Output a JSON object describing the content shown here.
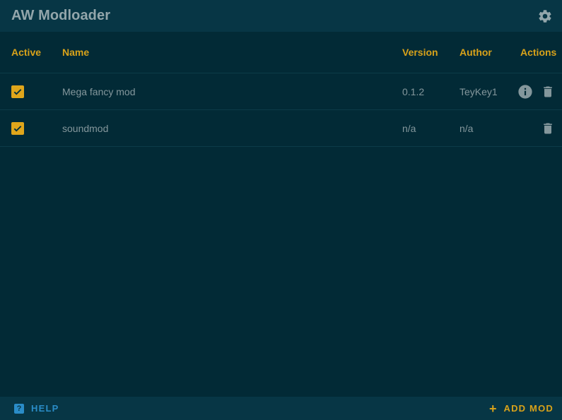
{
  "app": {
    "title": "AW Modloader"
  },
  "icons": {
    "settings": "gear-icon",
    "info": "info-icon",
    "delete": "trash-icon",
    "help": "help-icon",
    "add": "plus-icon",
    "check": "checkmark-icon"
  },
  "colors": {
    "accent": "#d8a21a",
    "help": "#2a8cc7",
    "background": "#022a36",
    "bar": "#073645",
    "text": "#84979c"
  },
  "table": {
    "headers": {
      "active": "Active",
      "name": "Name",
      "version": "Version",
      "author": "Author",
      "actions": "Actions"
    },
    "rows": [
      {
        "active": true,
        "name": "Mega fancy mod",
        "version": "0.1.2",
        "author": "TeyKey1",
        "has_info": true
      },
      {
        "active": true,
        "name": "soundmod",
        "version": "n/a",
        "author": "n/a",
        "has_info": false
      }
    ]
  },
  "footer": {
    "help_label": "HELP",
    "help_glyph": "?",
    "add_label": "ADD MOD",
    "add_glyph": "+"
  }
}
